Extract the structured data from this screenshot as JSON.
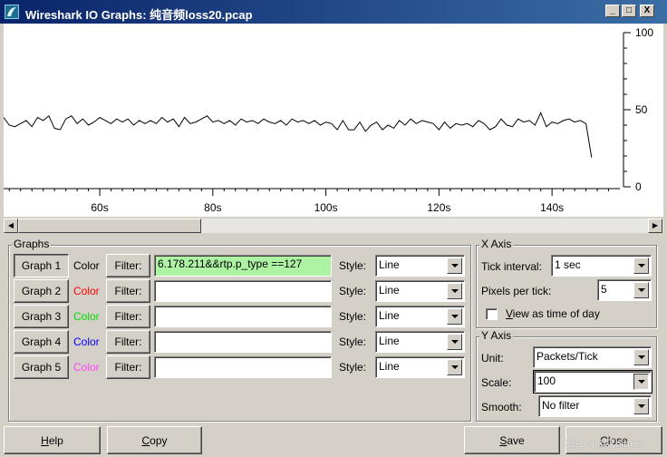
{
  "window": {
    "title": "Wireshark IO Graphs: 纯音频loss20.pcap",
    "minimize_glyph": "_",
    "maximize_glyph": "□",
    "close_glyph": "X",
    "icon": "wireshark-fin-icon"
  },
  "chart_data": {
    "type": "line",
    "xlabel": "",
    "ylabel": "",
    "x_ticks": [
      "60s",
      "80s",
      "100s",
      "120s",
      "140s"
    ],
    "y_ticks": [
      "100",
      "50",
      "0"
    ],
    "xlim": [
      43,
      152
    ],
    "ylim": [
      0,
      100
    ],
    "grid": false,
    "series": [
      {
        "color": "#000000",
        "x": [
          43,
          44,
          45,
          46,
          47,
          48,
          49,
          50,
          51,
          52,
          53,
          54,
          55,
          56,
          57,
          58,
          59,
          60,
          61,
          62,
          63,
          64,
          65,
          66,
          67,
          68,
          69,
          70,
          71,
          72,
          73,
          74,
          75,
          76,
          77,
          78,
          79,
          80,
          81,
          82,
          83,
          84,
          85,
          86,
          87,
          88,
          89,
          90,
          91,
          92,
          93,
          94,
          95,
          96,
          97,
          98,
          99,
          100,
          101,
          102,
          103,
          104,
          105,
          106,
          107,
          108,
          109,
          110,
          111,
          112,
          113,
          114,
          115,
          116,
          117,
          118,
          119,
          120,
          121,
          122,
          123,
          124,
          125,
          126,
          127,
          128,
          129,
          130,
          131,
          132,
          133,
          134,
          135,
          136,
          137,
          138,
          139,
          140,
          141,
          142,
          143,
          144,
          145,
          146,
          147
        ],
        "values": [
          45,
          40,
          39,
          41,
          43,
          39,
          45,
          43,
          46,
          38,
          37,
          44,
          46,
          41,
          44,
          40,
          42,
          45,
          43,
          41,
          44,
          42,
          44,
          40,
          43,
          41,
          43,
          41,
          45,
          42,
          44,
          39,
          45,
          41,
          42,
          44,
          46,
          42,
          43,
          41,
          43,
          40,
          44,
          42,
          43,
          41,
          44,
          42,
          41,
          43,
          40,
          44,
          42,
          43,
          41,
          43,
          40,
          42,
          41,
          37,
          43,
          37,
          37,
          42,
          36,
          40,
          42,
          37,
          40,
          38,
          43,
          40,
          44,
          41,
          43,
          42,
          41,
          37,
          42,
          38,
          41,
          40,
          41,
          39,
          43,
          41,
          37,
          39,
          44,
          40,
          39,
          44,
          42,
          43,
          40,
          48,
          39,
          42,
          41,
          43,
          44,
          42,
          43,
          41,
          19
        ]
      }
    ]
  },
  "scrollbar": {
    "left_glyph": "◀",
    "right_glyph": "▶"
  },
  "graphs_group": {
    "title": "Graphs",
    "rows": [
      {
        "button": "Graph 1",
        "color_label": "Color",
        "color": "#000000",
        "filter_button": "Filter:",
        "filter_value": "6.178.211&&rtp.p_type ==127",
        "style_label": "Style:",
        "style_value": "Line"
      },
      {
        "button": "Graph 2",
        "color_label": "Color",
        "color": "#ff0000",
        "filter_button": "Filter:",
        "filter_value": "",
        "style_label": "Style:",
        "style_value": "Line"
      },
      {
        "button": "Graph 3",
        "color_label": "Color",
        "color": "#00dd00",
        "filter_button": "Filter:",
        "filter_value": "",
        "style_label": "Style:",
        "style_value": "Line"
      },
      {
        "button": "Graph 4",
        "color_label": "Color",
        "color": "#0000ff",
        "filter_button": "Filter:",
        "filter_value": "",
        "style_label": "Style:",
        "style_value": "Line"
      },
      {
        "button": "Graph 5",
        "color_label": "Color",
        "color": "#ff44ff",
        "filter_button": "Filter:",
        "filter_value": "",
        "style_label": "Style:",
        "style_value": "Line"
      }
    ]
  },
  "x_axis_group": {
    "title": "X Axis",
    "tick_interval_label": "Tick interval:",
    "tick_interval_value": "1 sec",
    "pixels_per_tick_label": "Pixels per tick:",
    "pixels_per_tick_value": "5",
    "view_time_of_day_label": "View as time of day",
    "view_time_of_day_checked": false
  },
  "y_axis_group": {
    "title": "Y Axis",
    "unit_label": "Unit:",
    "unit_value": "Packets/Tick",
    "scale_label": "Scale:",
    "scale_value": "100",
    "smooth_label": "Smooth:",
    "smooth_value": "No filter"
  },
  "bottom_buttons": {
    "help": "Help",
    "copy": "Copy",
    "save": "Save",
    "close": "Close"
  },
  "watermark": "CSDN @Thinker"
}
